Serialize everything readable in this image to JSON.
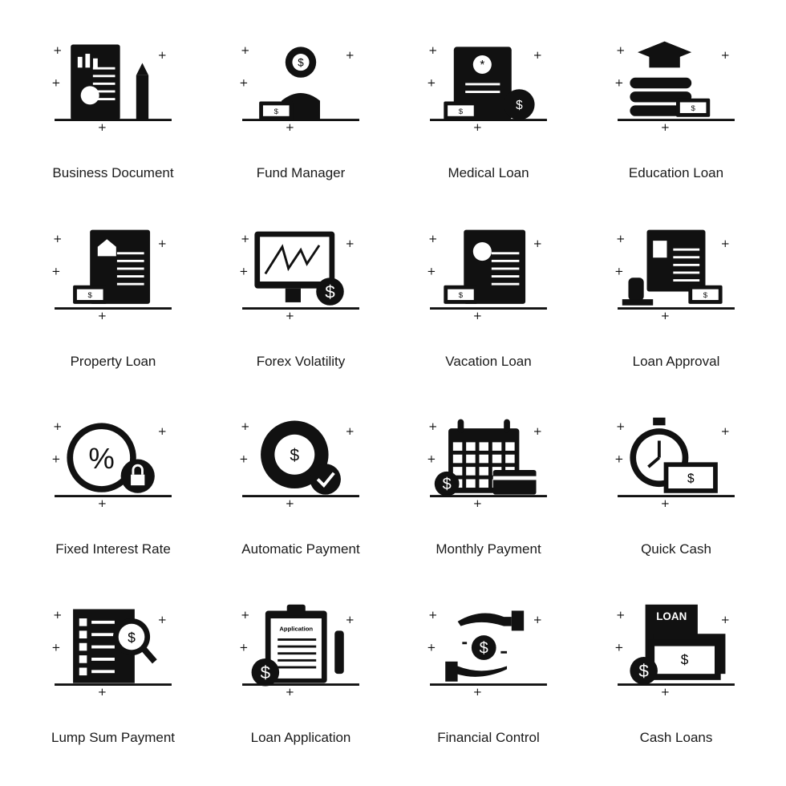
{
  "colors": {
    "icon": "#111111",
    "background": "#ffffff",
    "text": "#1a1a1a"
  },
  "icons": [
    {
      "label": "Business Document",
      "icon": "business-document-icon"
    },
    {
      "label": "Fund Manager",
      "icon": "fund-manager-icon"
    },
    {
      "label": "Medical Loan",
      "icon": "medical-loan-icon"
    },
    {
      "label": "Education Loan",
      "icon": "education-loan-icon"
    },
    {
      "label": "Property Loan",
      "icon": "property-loan-icon"
    },
    {
      "label": "Forex Volatility",
      "icon": "forex-volatility-icon"
    },
    {
      "label": "Vacation Loan",
      "icon": "vacation-loan-icon"
    },
    {
      "label": "Loan Approval",
      "icon": "loan-approval-icon"
    },
    {
      "label": "Fixed Interest Rate",
      "icon": "fixed-interest-rate-icon"
    },
    {
      "label": "Automatic Payment",
      "icon": "automatic-payment-icon"
    },
    {
      "label": "Monthly Payment",
      "icon": "monthly-payment-icon"
    },
    {
      "label": "Quick Cash",
      "icon": "quick-cash-icon"
    },
    {
      "label": "Lump Sum Payment",
      "icon": "lump-sum-payment-icon"
    },
    {
      "label": "Loan Application",
      "icon": "loan-application-icon",
      "text": "Application"
    },
    {
      "label": "Financial Control",
      "icon": "financial-control-icon"
    },
    {
      "label": "Cash Loans",
      "icon": "cash-loans-icon",
      "text": "LOAN"
    }
  ]
}
